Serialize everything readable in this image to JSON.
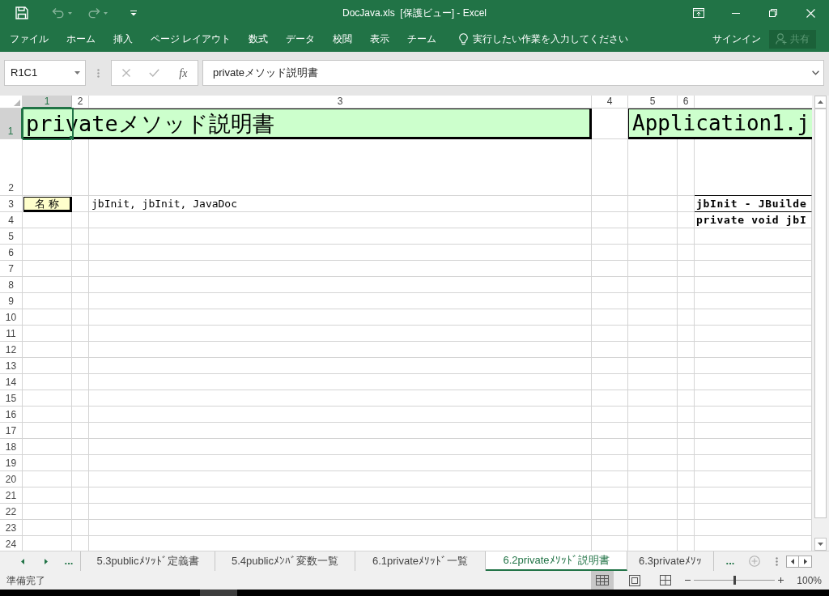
{
  "window": {
    "title": "DocJava.xls  [保護ビュー] - Excel"
  },
  "quick_access": {
    "undo": {
      "disabled": true
    },
    "redo": {
      "disabled": true
    }
  },
  "ribbon_tabs": [
    {
      "label": "ファイル"
    },
    {
      "label": "ホーム"
    },
    {
      "label": "挿入"
    },
    {
      "label": "ページ レイアウト"
    },
    {
      "label": "数式"
    },
    {
      "label": "データ"
    },
    {
      "label": "校閲"
    },
    {
      "label": "表示"
    },
    {
      "label": "チーム"
    }
  ],
  "tell_me": {
    "placeholder": "実行したい作業を入力してください"
  },
  "account": {
    "sign_in": "サインイン",
    "share": {
      "label": "共有",
      "disabled": true
    }
  },
  "formula_bar": {
    "name_box": "R1C1",
    "insert_function": "fx",
    "formula": "privateメソッド説明書"
  },
  "sheet": {
    "columns": [
      {
        "label": "1",
        "selected": true
      },
      {
        "label": "2",
        "selected": false
      },
      {
        "label": "3",
        "selected": false
      },
      {
        "label": "4",
        "selected": false
      },
      {
        "label": "5",
        "selected": false
      },
      {
        "label": "6",
        "selected": false
      }
    ],
    "rows": [
      {
        "label": "1",
        "selected": true
      },
      {
        "label": "2",
        "selected": false
      },
      {
        "label": "3",
        "selected": false
      },
      {
        "label": "4",
        "selected": false
      },
      {
        "label": "5",
        "selected": false
      },
      {
        "label": "6",
        "selected": false
      },
      {
        "label": "7",
        "selected": false
      },
      {
        "label": "8",
        "selected": false
      },
      {
        "label": "9",
        "selected": false
      },
      {
        "label": "10",
        "selected": false
      },
      {
        "label": "11",
        "selected": false
      },
      {
        "label": "12",
        "selected": false
      },
      {
        "label": "13",
        "selected": false
      },
      {
        "label": "14",
        "selected": false
      },
      {
        "label": "15",
        "selected": false
      },
      {
        "label": "16",
        "selected": false
      },
      {
        "label": "17",
        "selected": false
      },
      {
        "label": "18",
        "selected": false
      },
      {
        "label": "19",
        "selected": false
      },
      {
        "label": "20",
        "selected": false
      },
      {
        "label": "21",
        "selected": false
      },
      {
        "label": "22",
        "selected": false
      },
      {
        "label": "23",
        "selected": false
      },
      {
        "label": "24",
        "selected": false
      }
    ],
    "banners": [
      "privateメソッド説明書",
      "Application1.j"
    ],
    "name_label": "名 称",
    "name_value": "jbInit, jbInit, JavaDoc",
    "doc_lines": [
      "jbInit - JBuilde",
      "private void jbI"
    ]
  },
  "sheet_tabs": {
    "more_left": "...",
    "tabs": [
      {
        "label": "5.3publicﾒｿｯﾄﾞ定義書",
        "selected": false
      },
      {
        "label": "5.4publicﾒﾝﾊﾞ変数一覧",
        "selected": false
      },
      {
        "label": "6.1privateﾒｿｯﾄﾞ一覧",
        "selected": false
      },
      {
        "label": "6.2privateﾒｿｯﾄﾞ説明書",
        "selected": true
      },
      {
        "label": "6.3privateﾒｿｯ",
        "selected": false
      }
    ],
    "more_right": "..."
  },
  "status_bar": {
    "status": "準備完了",
    "views": [
      {
        "kind": "normal",
        "selected": true
      },
      {
        "kind": "page_layout",
        "selected": false
      },
      {
        "kind": "page_break",
        "selected": false
      }
    ],
    "zoom": {
      "level": 0.5,
      "reading": "100%"
    }
  }
}
